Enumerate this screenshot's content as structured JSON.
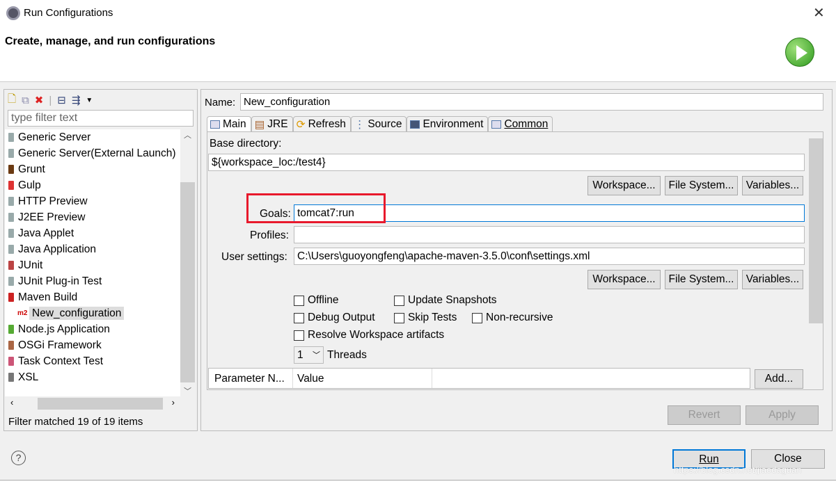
{
  "window": {
    "title": "Run Configurations",
    "header": "Create, manage, and run configurations"
  },
  "left": {
    "filter_placeholder": "type filter text",
    "items": [
      {
        "label": "Generic Server",
        "icon": "server-icon"
      },
      {
        "label": "Generic Server(External Launch)",
        "icon": "server-icon"
      },
      {
        "label": "Grunt",
        "icon": "grunt-icon"
      },
      {
        "label": "Gulp",
        "icon": "gulp-icon"
      },
      {
        "label": "HTTP Preview",
        "icon": "server-icon"
      },
      {
        "label": "J2EE Preview",
        "icon": "server-icon"
      },
      {
        "label": "Java Applet",
        "icon": "applet-icon"
      },
      {
        "label": "Java Application",
        "icon": "java-app-icon"
      },
      {
        "label": "JUnit",
        "icon": "junit-icon"
      },
      {
        "label": "JUnit Plug-in Test",
        "icon": "junit-plugin-icon"
      },
      {
        "label": "Maven Build",
        "icon": "maven-icon"
      },
      {
        "label": "New_configuration",
        "icon": "m2-icon",
        "badge": "m2"
      },
      {
        "label": "Node.js Application",
        "icon": "nodejs-icon"
      },
      {
        "label": "OSGi Framework",
        "icon": "osgi-icon"
      },
      {
        "label": "Task Context Test",
        "icon": "task-icon"
      },
      {
        "label": "XSL",
        "icon": "xsl-icon"
      }
    ],
    "status": "Filter matched 19 of 19 items"
  },
  "right": {
    "name_label": "Name:",
    "name_value": "New_configuration",
    "tabs": [
      "Main",
      "JRE",
      "Refresh",
      "Source",
      "Environment",
      "Common"
    ],
    "base_dir_label": "Base directory:",
    "base_dir_value": "${workspace_loc:/test4}",
    "workspace_btn": "Workspace...",
    "filesystem_btn": "File System...",
    "variables_btn": "Variables...",
    "goals_label": "Goals:",
    "goals_value": "tomcat7:run",
    "profiles_label": "Profiles:",
    "profiles_value": "",
    "user_settings_label": "User settings:",
    "user_settings_value": "C:\\Users\\guoyongfeng\\apache-maven-3.5.0\\conf\\settings.xml",
    "checkboxes": {
      "offline": "Offline",
      "update_snapshots": "Update Snapshots",
      "debug_output": "Debug Output",
      "skip_tests": "Skip Tests",
      "non_recursive": "Non-recursive",
      "resolve_workspace": "Resolve Workspace artifacts"
    },
    "threads_value": "1",
    "threads_label": "Threads",
    "param_col_name": "Parameter N...",
    "param_col_value": "Value",
    "add_btn": "Add...",
    "revert_btn": "Revert",
    "apply_btn": "Apply"
  },
  "footer": {
    "run_btn": "Run",
    "close_btn": "Close",
    "watermark": "https://blog.csdn.net/jiaodaguan"
  },
  "colors": {
    "highlight_box": "#e8192c",
    "focus_border": "#0078d7"
  }
}
